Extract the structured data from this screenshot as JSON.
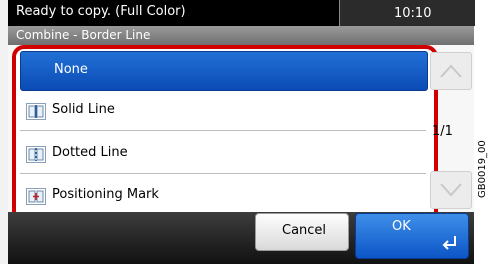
{
  "status": {
    "message": "Ready to copy. (Full Color)",
    "time": "10:10"
  },
  "header": {
    "title": "Combine - Border Line"
  },
  "list": {
    "items": [
      {
        "label": "None",
        "icon": "none",
        "selected": true
      },
      {
        "label": "Solid Line",
        "icon": "solid-line-icon",
        "selected": false
      },
      {
        "label": "Dotted Line",
        "icon": "dotted-line-icon",
        "selected": false
      },
      {
        "label": "Positioning Mark",
        "icon": "positioning-mark-icon",
        "selected": false
      }
    ]
  },
  "pager": {
    "page": "1/1"
  },
  "buttons": {
    "cancel": "Cancel",
    "ok": "OK"
  },
  "figure_code": "GB0019_00",
  "colors": {
    "accent": "#0b4bb5",
    "highlight_frame": "#d00000"
  }
}
